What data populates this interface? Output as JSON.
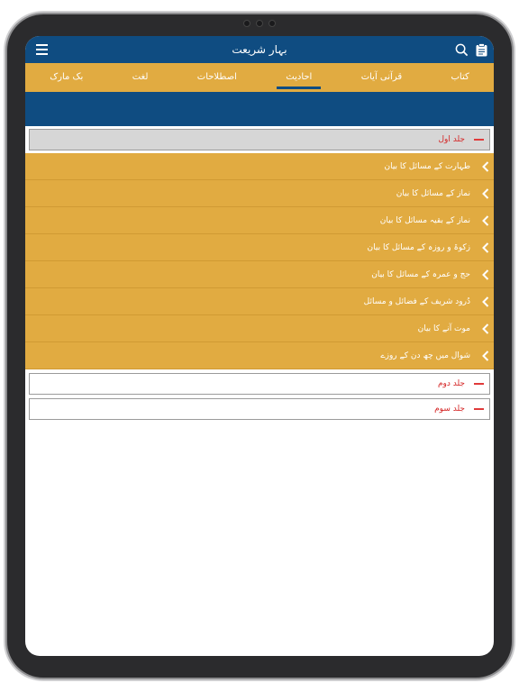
{
  "app": {
    "title": "بہار شریعت"
  },
  "tabs": [
    {
      "label": "کتاب",
      "active": false
    },
    {
      "label": "قرآنی آیات",
      "active": false
    },
    {
      "label": "احادیث",
      "active": true
    },
    {
      "label": "اصطلاحات",
      "active": false
    },
    {
      "label": "لغت",
      "active": false
    },
    {
      "label": "بک مارک",
      "active": false
    }
  ],
  "sections": [
    {
      "label": "جلد اول",
      "expanded": true,
      "items": [
        "طہارت کے مسائل کا بیان",
        "نماز کے مسائل کا بیان",
        "نماز کے بقیہ مسائل کا بیان",
        "زکوۃ و روزہ کے مسائل کا بیان",
        "حج و عمرہ کے مسائل کا بیان",
        "دُرود شریف کے فضائل و مسائل",
        "موت آنے کا بیان",
        "شوال میں چھ دن کے روزے"
      ]
    },
    {
      "label": "جلد دوم",
      "expanded": false,
      "items": []
    },
    {
      "label": "جلد سوم",
      "expanded": false,
      "items": []
    }
  ],
  "colors": {
    "primary": "#0f4c81",
    "accent": "#e1ab41",
    "section_text": "#d42424"
  },
  "icons": {
    "menu": "menu-icon",
    "search": "search-icon",
    "clipboard": "clipboard-icon",
    "chevron": "chevron-left-icon",
    "collapse": "minus-icon"
  }
}
